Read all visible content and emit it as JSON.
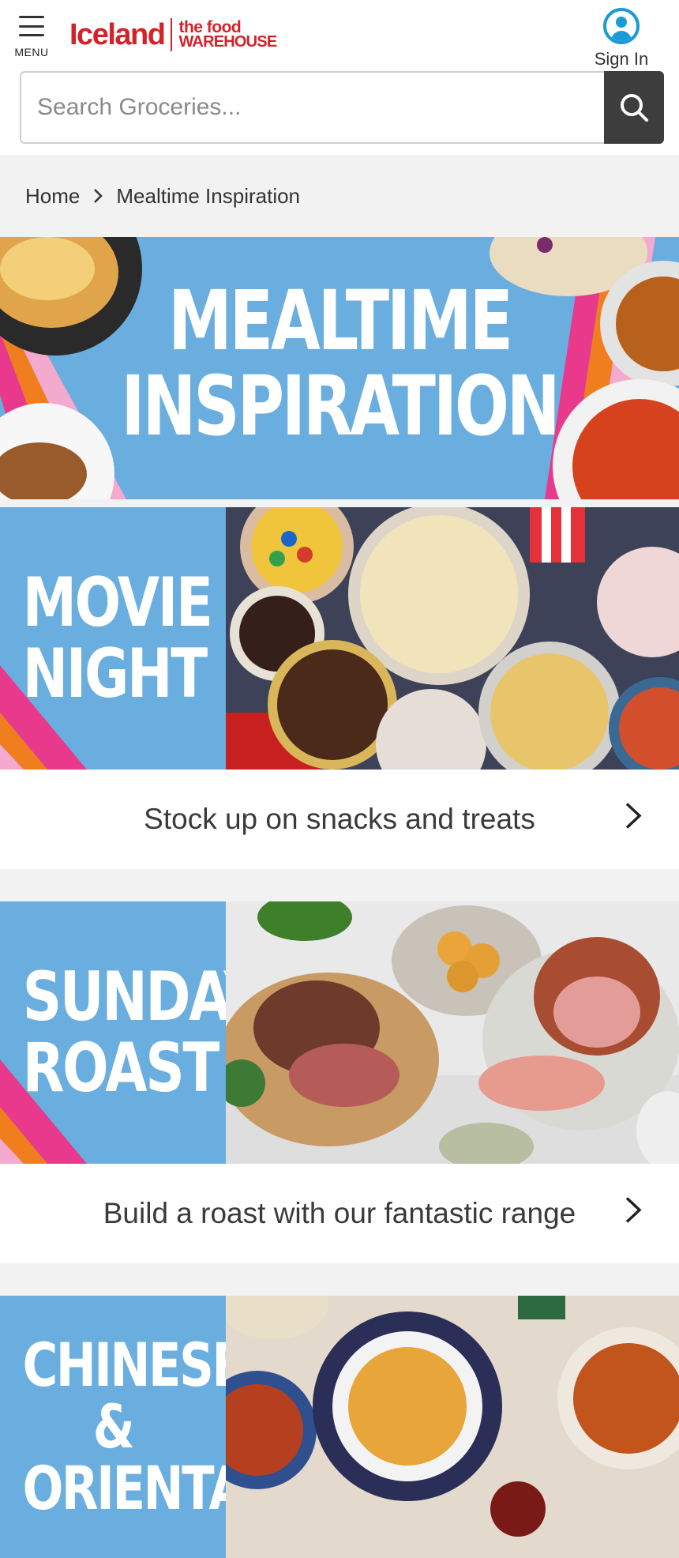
{
  "header": {
    "menu_label": "MENU",
    "logo_brand": "Iceland",
    "logo_sub_line1": "the food",
    "logo_sub_line2": "WAREHOUSE",
    "signin_label": "Sign In",
    "search_placeholder": "Search Groceries..."
  },
  "breadcrumb": {
    "home": "Home",
    "current": "Mealtime Inspiration"
  },
  "hero": {
    "line1": "MEALTIME",
    "line2": "INSPIRATION"
  },
  "cards": [
    {
      "banner_line1": "MOVIE",
      "banner_line2": "NIGHT",
      "cta": "Stock up on snacks and treats"
    },
    {
      "banner_line1": "SUNDAY",
      "banner_line2": "ROAST",
      "cta": "Build a roast with our fantastic range"
    },
    {
      "banner_line1": "CHINESE &",
      "banner_line2": "ORIENTAL"
    }
  ],
  "colors": {
    "brand_red": "#d2232a",
    "banner_blue": "#6aaee0",
    "accent_blue": "#1a9ad6",
    "search_button": "#3d3d3d"
  },
  "icons": {
    "menu": "hamburger-icon",
    "account": "user-circle-icon",
    "search": "search-icon",
    "chevron": "chevron-right-icon"
  }
}
